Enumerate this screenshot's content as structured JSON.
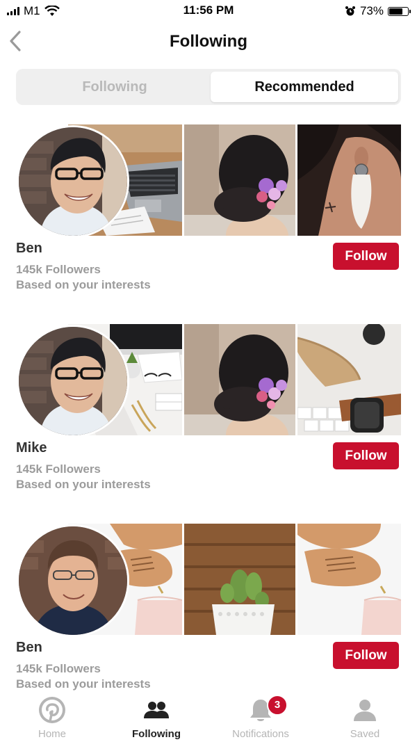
{
  "status_bar": {
    "carrier": "M1",
    "time": "11:56 PM",
    "battery": "73%",
    "battery_level": 0.73
  },
  "nav": {
    "title": "Following",
    "back_icon": "chevron-left-icon"
  },
  "segmented": {
    "left": "Following",
    "right": "Recommended",
    "selected": "Recommended"
  },
  "cards": [
    {
      "name": "Ben",
      "followers": "145k Followers",
      "reason": "Based on your interests",
      "button": "Follow"
    },
    {
      "name": "Mike",
      "followers": "145k Followers",
      "reason": "Based on your interests",
      "button": "Follow"
    },
    {
      "name": "Ben",
      "followers": "145k Followers",
      "reason": "Based on your interests",
      "button": "Follow"
    }
  ],
  "tabbar": {
    "tabs": [
      {
        "label": "Home",
        "icon": "pinterest-icon"
      },
      {
        "label": "Following",
        "icon": "people-icon"
      },
      {
        "label": "Notifications",
        "icon": "bell-icon",
        "badge": "3"
      },
      {
        "label": "Saved",
        "icon": "profile-icon"
      }
    ],
    "active": "Following"
  },
  "colors": {
    "accent": "#c8102e",
    "muted_text": "#9b9b9b",
    "segment_bg": "#efefef"
  }
}
